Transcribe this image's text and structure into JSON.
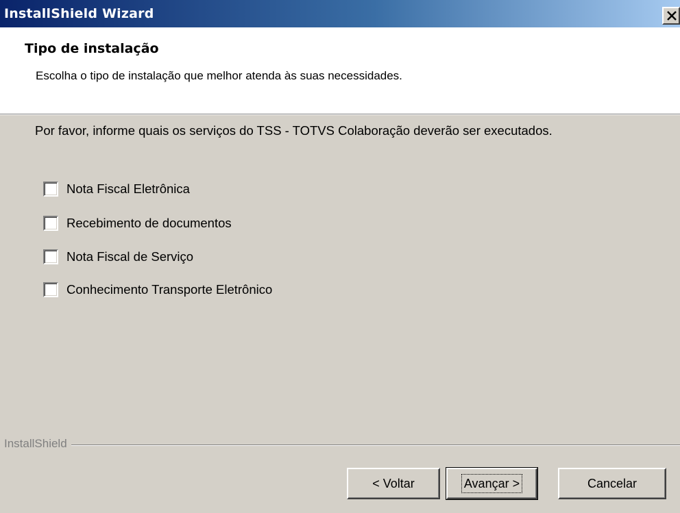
{
  "window": {
    "title": "InstallShield Wizard"
  },
  "header": {
    "title": "Tipo de instalação",
    "description": "Escolha o tipo de instalação que melhor atenda às suas necessidades."
  },
  "main": {
    "instruction": "Por favor, informe quais os serviços do TSS - TOTVS Colaboração deverão ser executados.",
    "options": [
      {
        "label": "Nota Fiscal Eletrônica",
        "checked": false
      },
      {
        "label": "Recebimento de documentos",
        "checked": false
      },
      {
        "label": "Nota Fiscal de Serviço",
        "checked": false
      },
      {
        "label": "Conhecimento Transporte Eletrônico",
        "checked": false
      }
    ]
  },
  "footer": {
    "brand": "InstallShield",
    "back_label": "< Voltar",
    "next_label": "Avançar >",
    "cancel_label": "Cancelar"
  },
  "icons": {
    "close": "close-icon"
  }
}
